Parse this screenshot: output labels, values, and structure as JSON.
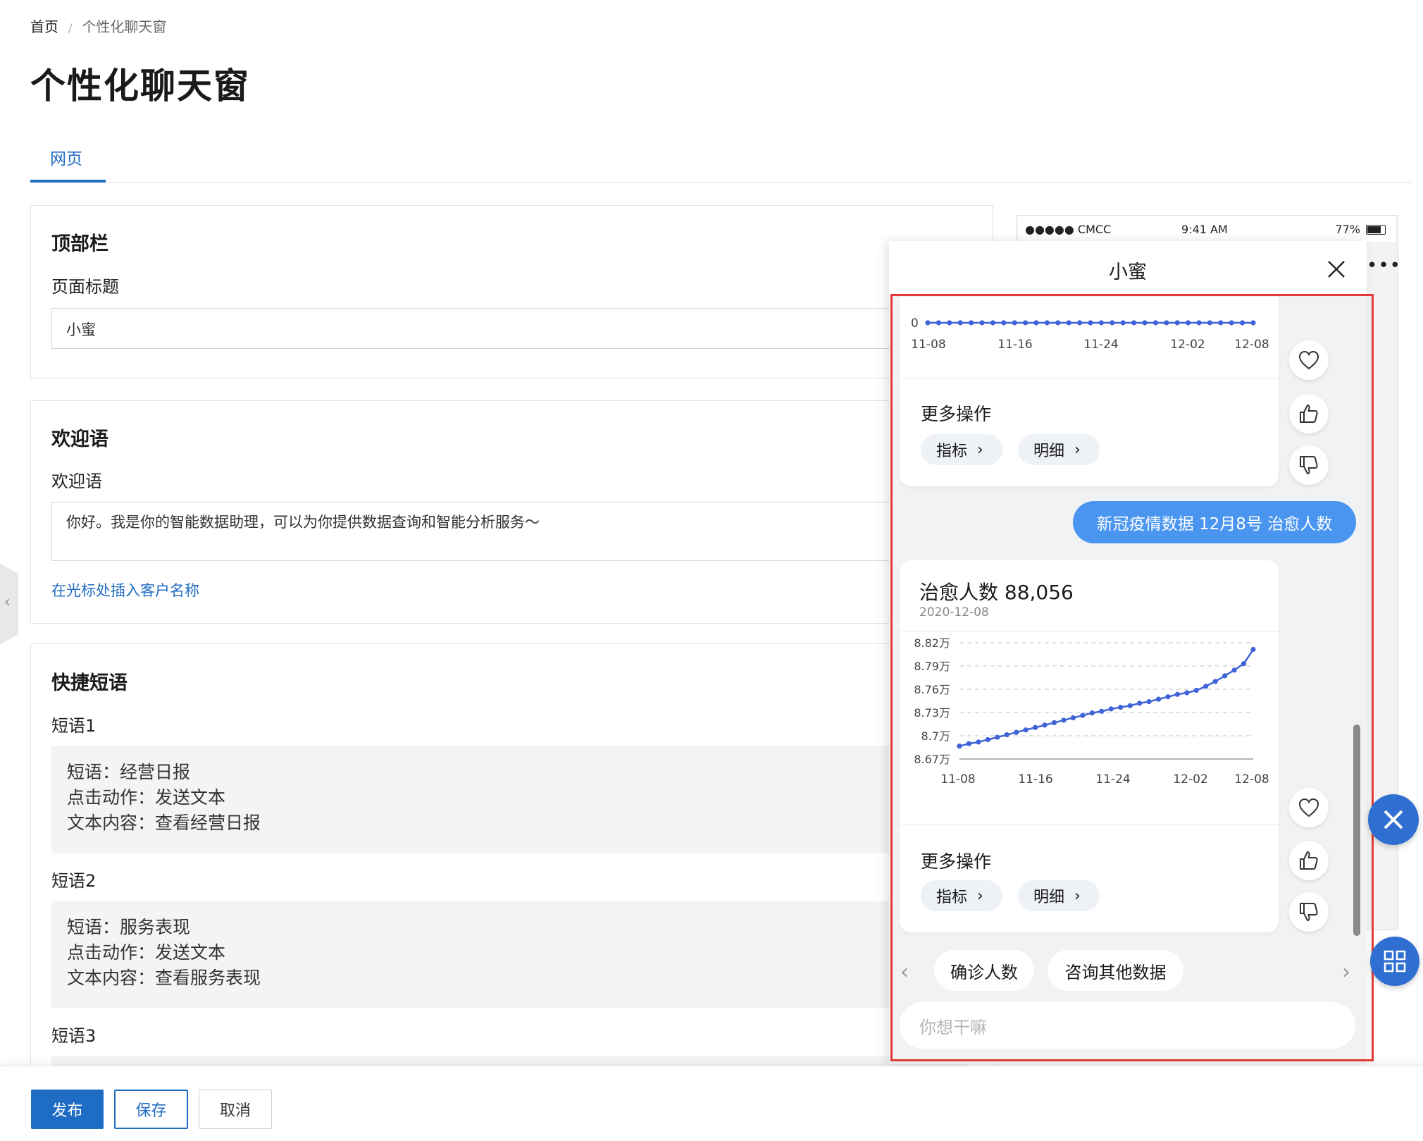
{
  "breadcrumb": {
    "home": "首页",
    "separator": "/",
    "current": "个性化聊天窗"
  },
  "page": {
    "title": "个性化聊天窗"
  },
  "tabs": [
    {
      "label": "网页"
    }
  ],
  "topbar": {
    "section_title": "顶部栏",
    "field_label": "页面标题",
    "field_value": "小蜜"
  },
  "welcome": {
    "section_title": "欢迎语",
    "field_label": "欢迎语",
    "field_value": "你好。我是你的智能数据助理，可以为你提供数据查询和智能分析服务～",
    "insert_link": "在光标处插入客户名称"
  },
  "shortcuts": {
    "section_title": "快捷短语",
    "items": [
      {
        "label": "短语1",
        "line1": "短语：经营日报",
        "line2": "点击动作：发送文本",
        "line3": "文本内容：查看经营日报"
      },
      {
        "label": "短语2",
        "line1": "短语：服务表现",
        "line2": "点击动作：发送文本",
        "line3": "文本内容：查看服务表现"
      },
      {
        "label": "短语3"
      }
    ]
  },
  "footer": {
    "publish": "发布",
    "save": "保存",
    "cancel": "取消"
  },
  "phone": {
    "carrier": "●●●●● CMCC",
    "time": "9:41 AM",
    "battery": "77%",
    "menu": "•••"
  },
  "chat": {
    "title": "小蜜",
    "close_icon": "close-icon",
    "more_actions": "更多操作",
    "pill_metric": "指标",
    "pill_detail": "明细",
    "user_message": "新冠疫情数据 12月8号 治愈人数",
    "metric_name": "治愈人数 88,056",
    "metric_date": "2020-12-08",
    "quick_replies": [
      "确诊人数",
      "咨询其他数据"
    ],
    "input_placeholder": "你想干嘛"
  },
  "colors": {
    "accent": "#1f6cc4",
    "bubble": "#4a95ef",
    "line": "#3f63d6",
    "frame": "#e53935"
  },
  "chart_data": [
    {
      "type": "line",
      "title": "",
      "x": [
        "11-08",
        "11-16",
        "11-24",
        "12-02",
        "12-08"
      ],
      "y_tick_labels": [
        "0"
      ],
      "series": [
        {
          "values": [
            0,
            0,
            0,
            0,
            0,
            0,
            0,
            0,
            0,
            0,
            0,
            0,
            0,
            0,
            0,
            0,
            0,
            0,
            0,
            0,
            0,
            0,
            0,
            0,
            0,
            0,
            0,
            0,
            0,
            0,
            0
          ]
        }
      ],
      "xlabel": "",
      "ylabel": ""
    },
    {
      "type": "line",
      "title": "",
      "x": [
        "11-08",
        "11-16",
        "11-24",
        "12-02",
        "12-08"
      ],
      "y_tick_labels": [
        "8.82万",
        "8.79万",
        "8.76万",
        "8.73万",
        "8.7万",
        "8.67万"
      ],
      "ylim": [
        86700,
        88200
      ],
      "series": [
        {
          "values": [
            86860,
            86890,
            86910,
            86940,
            86970,
            87000,
            87030,
            87060,
            87090,
            87120,
            87150,
            87180,
            87210,
            87240,
            87270,
            87290,
            87320,
            87340,
            87360,
            87390,
            87410,
            87440,
            87470,
            87500,
            87520,
            87550,
            87600,
            87660,
            87730,
            87800,
            87880,
            88056
          ]
        }
      ],
      "grid": true,
      "xlabel": "",
      "ylabel": ""
    }
  ]
}
